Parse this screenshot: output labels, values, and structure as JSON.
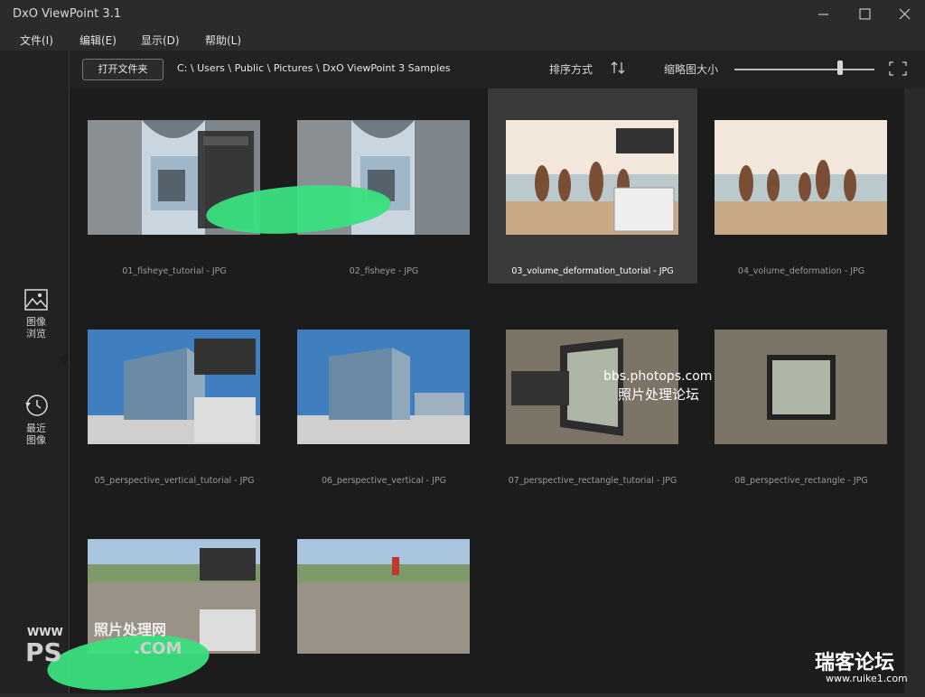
{
  "window": {
    "title": "DxO ViewPoint 3.1"
  },
  "menu": [
    "文件(I)",
    "编辑(E)",
    "显示(D)",
    "帮助(L)"
  ],
  "sidebar": {
    "items": [
      {
        "label": "图像\n浏览",
        "icon": "image-icon"
      },
      {
        "label": "最近\n图像",
        "icon": "history-icon"
      }
    ]
  },
  "toolbar": {
    "open_folder": "打开文件夹",
    "path": "C: \\ Users \\ Public \\ Pictures \\ DxO ViewPoint 3 Samples",
    "sort_label": "排序方式",
    "thumb_size_label": "缩略图大小",
    "thumb_size_level": 0.75
  },
  "images": [
    {
      "caption": "01_fisheye_tutorial - JPG"
    },
    {
      "caption": "02_fisheye - JPG"
    },
    {
      "caption": "03_volume_deformation_tutorial - JPG"
    },
    {
      "caption": "04_volume_deformation - JPG"
    },
    {
      "caption": "05_perspective_vertical_tutorial - JPG"
    },
    {
      "caption": "06_perspective_vertical - JPG"
    },
    {
      "caption": "07_perspective_rectangle_tutorial - JPG"
    },
    {
      "caption": "08_perspective_rectangle - JPG"
    },
    {
      "caption": ""
    },
    {
      "caption": ""
    }
  ],
  "watermarks": {
    "center_url": "bbs.photops.com",
    "center_cn": "照片处理论坛",
    "bottom_left_cn": "照片处理网",
    "bottom_left_url": "WWW",
    "bottom_left_ps": "PS",
    "bottom_left_com": ".COM",
    "bottom_right_cn": "瑞客论坛",
    "bottom_right_url": "www.ruike1.com"
  },
  "colors": {
    "accent_green": "#3ae07e",
    "content_bg": "#1c1c1c",
    "selected_tile": "#3a3a3a"
  }
}
